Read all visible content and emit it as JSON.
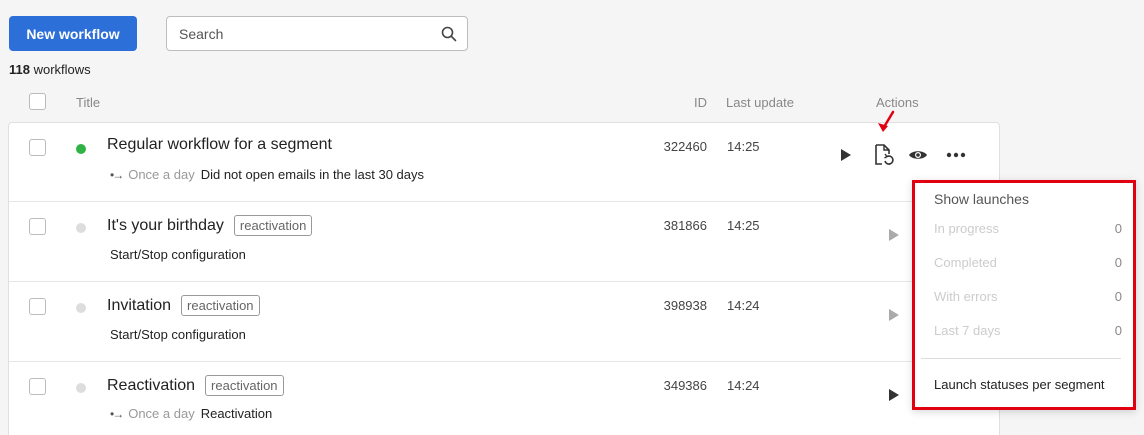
{
  "toolbar": {
    "new_workflow_label": "New workflow",
    "search_placeholder": "Search"
  },
  "summary": {
    "count": "118",
    "count_label": "workflows"
  },
  "table": {
    "headers": {
      "title": "Title",
      "id": "ID",
      "last_update": "Last update",
      "actions": "Actions"
    },
    "rows": [
      {
        "title": "Regular workflow for a segment",
        "tag": "",
        "active": true,
        "frequency": "Once a day",
        "description": "Did not open emails in the last 30 days",
        "id": "322460",
        "last_update": "14:25"
      },
      {
        "title": "It's your birthday",
        "tag": "reactivation",
        "active": false,
        "frequency": "",
        "description": "Start/Stop configuration",
        "id": "381866",
        "last_update": "14:25"
      },
      {
        "title": "Invitation",
        "tag": "reactivation",
        "active": false,
        "frequency": "",
        "description": "Start/Stop configuration",
        "id": "398938",
        "last_update": "14:24"
      },
      {
        "title": "Reactivation",
        "tag": "reactivation",
        "active": false,
        "frequency": "Once a day",
        "description": "Reactivation",
        "id": "349386",
        "last_update": "14:24"
      }
    ]
  },
  "launches_popup": {
    "title": "Show launches",
    "items": [
      {
        "label": "In progress",
        "value": "0"
      },
      {
        "label": "Completed",
        "value": "0"
      },
      {
        "label": "With errors",
        "value": "0"
      },
      {
        "label": "Last 7 days",
        "value": "0"
      }
    ],
    "link": "Launch statuses per segment"
  },
  "icons": {
    "search": "search-icon",
    "play": "play-icon",
    "launches": "launch-history-icon",
    "preview": "eye-icon",
    "more": "more-horizontal-icon",
    "arrow": "arrow-right-icon"
  },
  "colors": {
    "primary": "#2d6fd8",
    "active_dot": "#2fb344",
    "highlight": "#e0000f"
  }
}
